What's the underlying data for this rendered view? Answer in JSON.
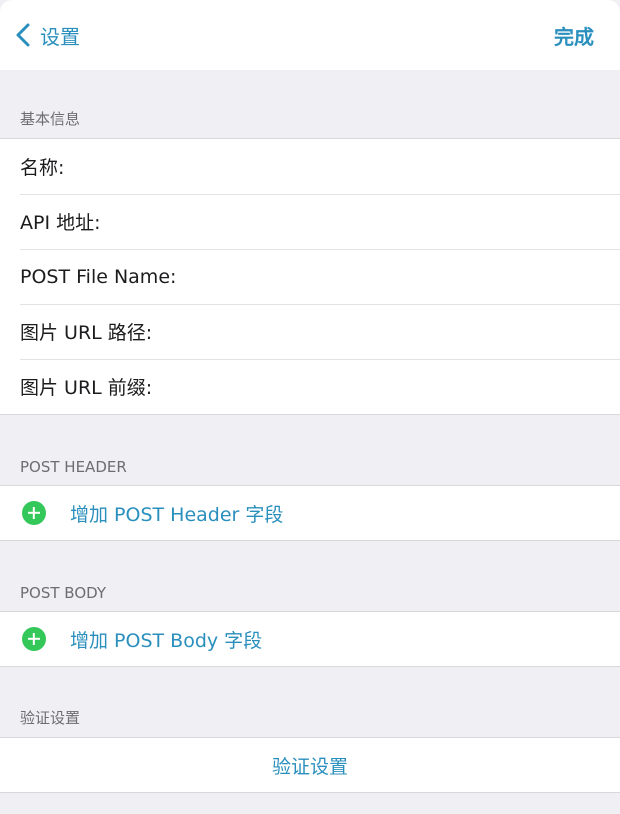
{
  "nav": {
    "back_label": "设置",
    "done_label": "完成"
  },
  "basic": {
    "header": "基本信息",
    "fields": [
      {
        "label": "名称:",
        "value": ""
      },
      {
        "label": "API 地址:",
        "value": ""
      },
      {
        "label": "POST File Name:",
        "value": ""
      },
      {
        "label": "图片 URL 路径:",
        "value": ""
      },
      {
        "label": "图片 URL 前缀:",
        "value": ""
      }
    ]
  },
  "post_header": {
    "header": "POST HEADER",
    "add_label": "增加 POST Header 字段"
  },
  "post_body": {
    "header": "POST BODY",
    "add_label": "增加 POST Body 字段"
  },
  "verify": {
    "header": "验证设置",
    "button_label": "验证设置"
  },
  "colors": {
    "accent": "#2a8fbd",
    "add_icon": "#34c759",
    "background": "#efeff4"
  },
  "icons": {
    "back": "chevron-left-icon",
    "add": "plus-circle-icon"
  }
}
